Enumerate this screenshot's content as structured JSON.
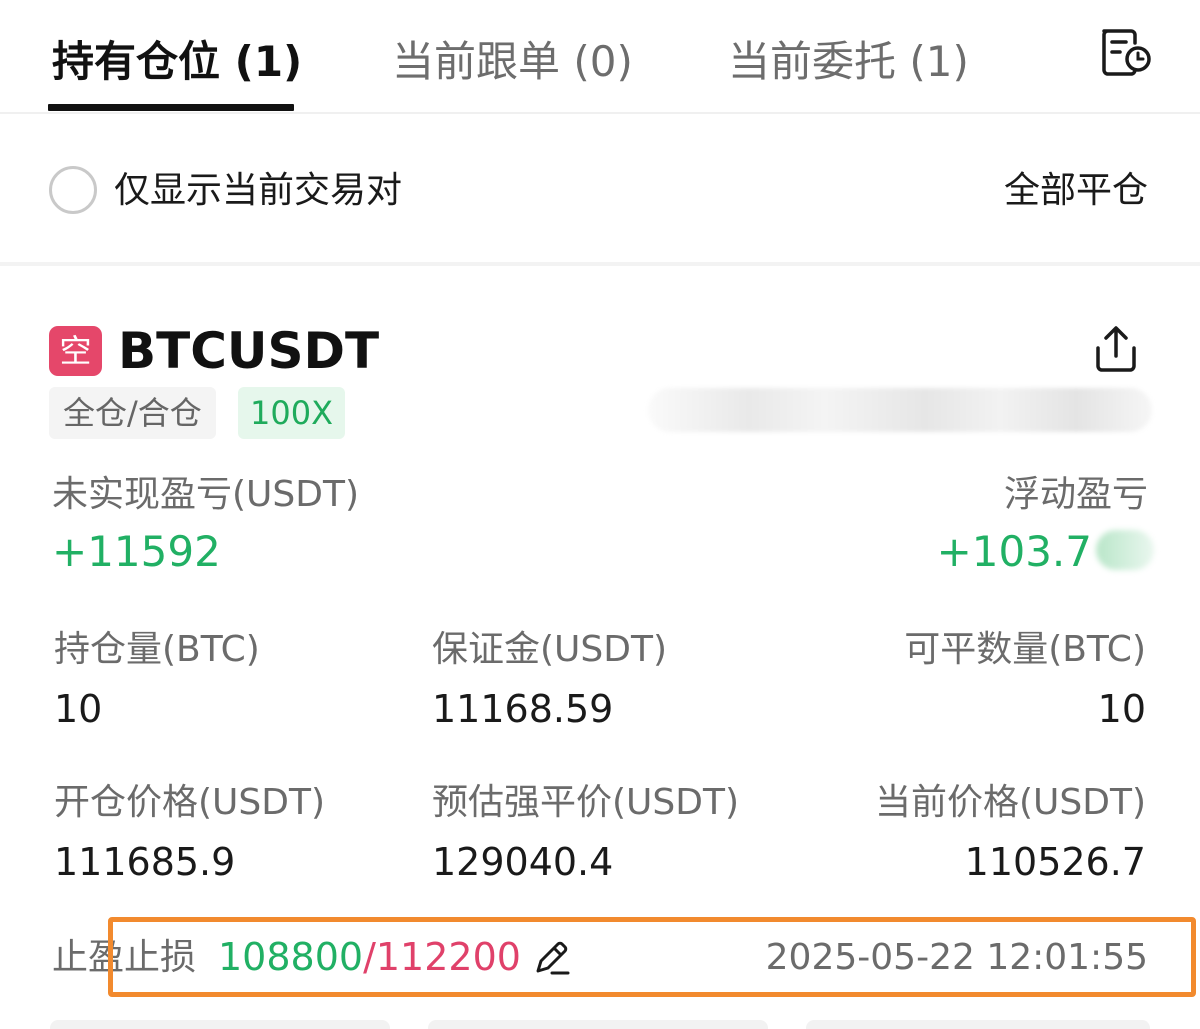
{
  "tabs": [
    {
      "label": "持有仓位 (1)",
      "active": true
    },
    {
      "label": "当前跟单 (0)",
      "active": false
    },
    {
      "label": "当前委托 (1)",
      "active": false
    }
  ],
  "icons": {
    "history": "order-history-icon",
    "share": "share-icon",
    "edit": "pencil-icon"
  },
  "filter": {
    "checkbox_label": "仅显示当前交易对",
    "checked": false,
    "close_all_label": "全部平仓"
  },
  "position": {
    "side_badge": "空",
    "symbol": "BTCUSDT",
    "margin_mode": "全仓/合仓",
    "leverage": "100X",
    "unrealized_pnl_label": "未实现盈亏(USDT)",
    "unrealized_pnl_value": "+11592",
    "floating_pnl_label": "浮动盈亏",
    "floating_pnl_value": "+103.7",
    "size_label": "持仓量(BTC)",
    "size_value": "10",
    "margin_label": "保证金(USDT)",
    "margin_value": "11168.59",
    "closable_label": "可平数量(BTC)",
    "closable_value": "10",
    "entry_price_label": "开仓价格(USDT)",
    "entry_price_value": "111685.9",
    "liq_price_label": "预估强平价(USDT)",
    "liq_price_value": "129040.4",
    "mark_price_label": "当前价格(USDT)",
    "mark_price_value": "110526.7",
    "tpsl_label": "止盈止损",
    "take_profit": "108800",
    "tpsl_separator": "/",
    "stop_loss": "112200",
    "timestamp": "2025-05-22 12:01:55"
  },
  "colors": {
    "profit": "#21b064",
    "loss": "#e0416a",
    "short_badge": "#e5476a",
    "highlight": "#f28a2e"
  }
}
